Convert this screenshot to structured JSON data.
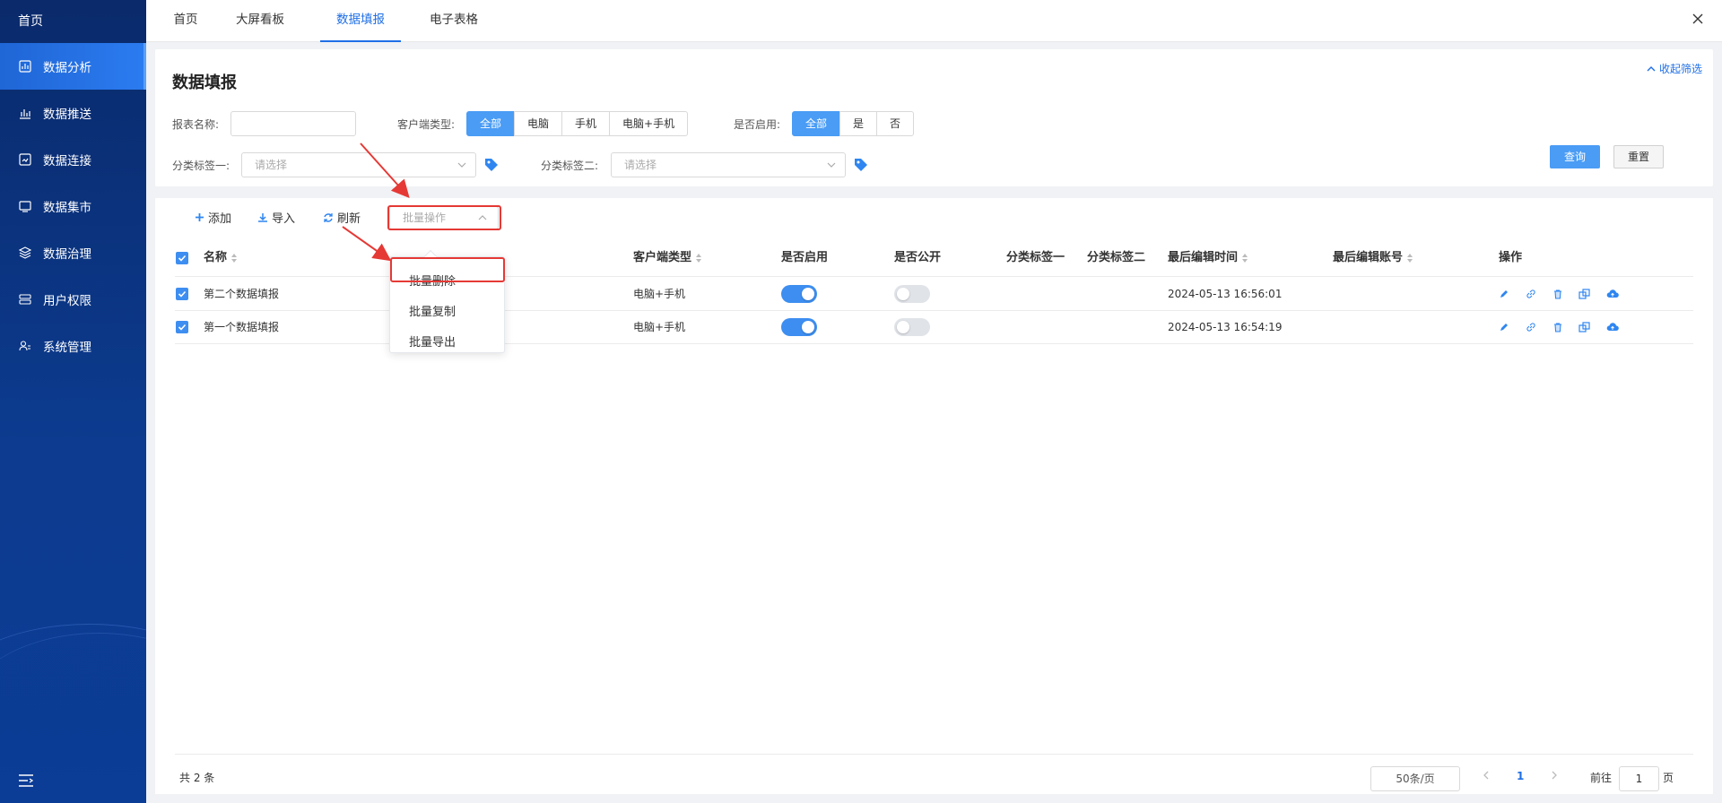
{
  "sidebar": {
    "home": "首页",
    "items": [
      {
        "label": "数据分析",
        "icon": "chart-box-icon",
        "active": true
      },
      {
        "label": "数据推送",
        "icon": "bar-chart-icon",
        "active": false
      },
      {
        "label": "数据连接",
        "icon": "connection-icon",
        "active": false
      },
      {
        "label": "数据集市",
        "icon": "monitor-icon",
        "active": false
      },
      {
        "label": "数据治理",
        "icon": "layers-icon",
        "active": false
      },
      {
        "label": "用户权限",
        "icon": "user-permission-icon",
        "active": false
      },
      {
        "label": "系统管理",
        "icon": "system-user-icon",
        "active": false
      }
    ]
  },
  "tabs": [
    {
      "label": "首页",
      "active": false
    },
    {
      "label": "大屏看板",
      "active": false
    },
    {
      "label": "数据填报",
      "active": true
    },
    {
      "label": "电子表格",
      "active": false
    }
  ],
  "filter": {
    "title": "数据填报",
    "collapse_label": "收起筛选",
    "report_name_label": "报表名称:",
    "report_name_value": "",
    "client_type_label": "客户端类型:",
    "client_type_options": [
      "全部",
      "电脑",
      "手机",
      "电脑+手机"
    ],
    "client_type_selected": "全部",
    "enabled_label": "是否启用:",
    "enabled_options": [
      "全部",
      "是",
      "否"
    ],
    "enabled_selected": "全部",
    "tag1_label": "分类标签一:",
    "tag1_placeholder": "请选择",
    "tag2_label": "分类标签二:",
    "tag2_placeholder": "请选择",
    "query_label": "查询",
    "reset_label": "重置"
  },
  "toolbar": {
    "add_label": "添加",
    "import_label": "导入",
    "refresh_label": "刷新",
    "batch_placeholder": "批量操作"
  },
  "batch_menu": [
    "批量删除",
    "批量复制",
    "批量导出"
  ],
  "table": {
    "columns": {
      "name": "名称",
      "client_type": "客户端类型",
      "enabled": "是否启用",
      "public": "是否公开",
      "tag1": "分类标签一",
      "tag2": "分类标签二",
      "last_edit_time": "最后编辑时间",
      "last_edit_account": "最后编辑账号",
      "actions": "操作"
    },
    "rows": [
      {
        "name": "第二个数据填报",
        "client_type": "电脑+手机",
        "enabled": true,
        "public": false,
        "tag1": "",
        "tag2": "",
        "last_edit_time": "2024-05-13 16:56:01",
        "last_edit_account": "",
        "checked": true
      },
      {
        "name": "第一个数据填报",
        "client_type": "电脑+手机",
        "enabled": true,
        "public": false,
        "tag1": "",
        "tag2": "",
        "last_edit_time": "2024-05-13 16:54:19",
        "last_edit_account": "",
        "checked": true
      }
    ]
  },
  "footer": {
    "total": "共 2 条",
    "page_size": "50条/页",
    "current_page": "1",
    "goto_label": "前往",
    "goto_value": "1",
    "page_unit": "页"
  },
  "colors": {
    "primary": "#4a9cf5",
    "sidebar_bg": "#0c3b8f",
    "highlight_red": "#e53935"
  }
}
